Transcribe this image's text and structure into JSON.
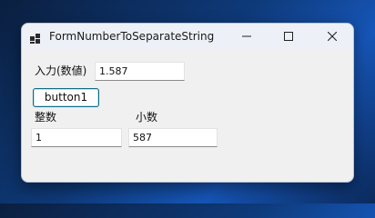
{
  "window": {
    "title": "FormNumberToSeparateString"
  },
  "form": {
    "input_label": "入力(数値)",
    "input_value": "1.587",
    "button_label": "button1",
    "integer_label": "整数",
    "integer_value": "1",
    "decimal_label": "小数",
    "decimal_value": "587"
  },
  "icons": {
    "app": "app-icon",
    "minimize": "minimize-icon",
    "maximize": "maximize-icon",
    "close": "close-icon"
  },
  "colors": {
    "accent_border": "#0f6a86",
    "window_bg": "#f0f0f0",
    "titlebar_bg": "#eef0f8"
  }
}
